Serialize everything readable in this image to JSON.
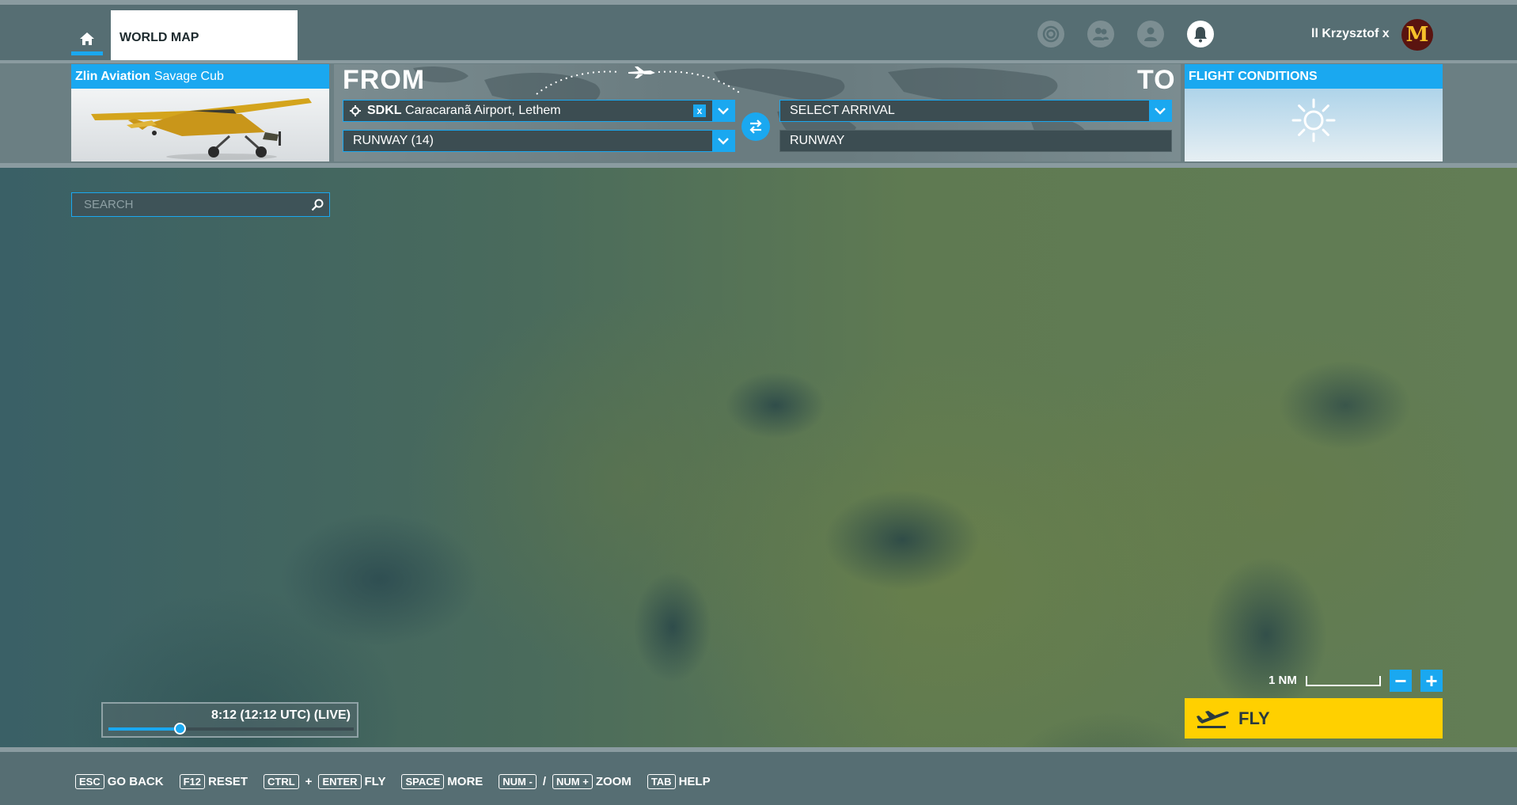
{
  "header": {
    "home_icon": "home-icon",
    "tab_label": "WORLD MAP",
    "icons": [
      "activity-icon",
      "friends-icon",
      "profile-icon",
      "notifications-icon"
    ],
    "username": "ll Krzysztof x",
    "avatar_icon": "mcdonalds-logo-icon"
  },
  "aircraft": {
    "brand": "Zlin Aviation",
    "model": "Savage Cub"
  },
  "route": {
    "from_label": "FROM",
    "to_label": "TO",
    "departure_code": "SDKL",
    "departure_name": "Caracaranã Airport, Lethem",
    "departure_clear": "x",
    "departure_runway": "RUNWAY (14)",
    "arrival_placeholder": "SELECT ARRIVAL",
    "arrival_runway": "RUNWAY"
  },
  "conditions": {
    "title": "FLIGHT CONDITIONS",
    "weather_icon": "sun-icon"
  },
  "search": {
    "placeholder": "SEARCH"
  },
  "time": {
    "label": "8:12 (12:12 UTC) (LIVE)",
    "slider_fraction": 0.29
  },
  "map": {
    "scale_label": "1 NM",
    "zoom_out": "−",
    "zoom_in": "+"
  },
  "fly": {
    "label": "FLY"
  },
  "hotkeys": {
    "esc_key": "ESC",
    "esc_label": "GO BACK",
    "f12_key": "F12",
    "f12_label": "RESET",
    "ctrl_key": "CTRL",
    "plus": "+",
    "enter_key": "ENTER",
    "enter_label": "FLY",
    "space_key": "SPACE",
    "space_label": "MORE",
    "numminus_key": "NUM -",
    "slash": "/",
    "numplus_key": "NUM +",
    "zoom_label": "ZOOM",
    "tab_key": "TAB",
    "tab_label": "HELP"
  },
  "colors": {
    "accent": "#1aa8f0",
    "fly": "#ffd000",
    "bar": "#566e73"
  }
}
